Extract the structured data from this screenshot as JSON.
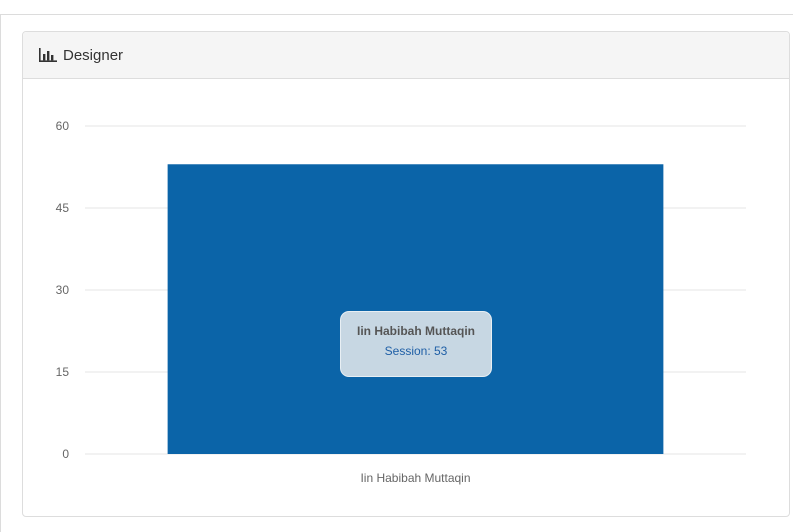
{
  "panel": {
    "title": "Designer",
    "icon": "bar-chart-icon"
  },
  "tooltip": {
    "title": "Iin Habibah Muttaqin",
    "label": "Session",
    "value": 53,
    "text": "Session: 53"
  },
  "colors": {
    "bar": "#0b64a8",
    "grid": "#e4e4e4",
    "tick_text": "#666666"
  },
  "chart_data": {
    "type": "bar",
    "categories": [
      "Iin Habibah Muttaqin"
    ],
    "series": [
      {
        "name": "Session",
        "values": [
          53
        ]
      }
    ],
    "title": "",
    "xlabel": "",
    "ylabel": "",
    "ylim": [
      0,
      60
    ],
    "yticks": [
      0,
      15,
      30,
      45,
      60
    ],
    "grid": true,
    "legend": "none"
  }
}
